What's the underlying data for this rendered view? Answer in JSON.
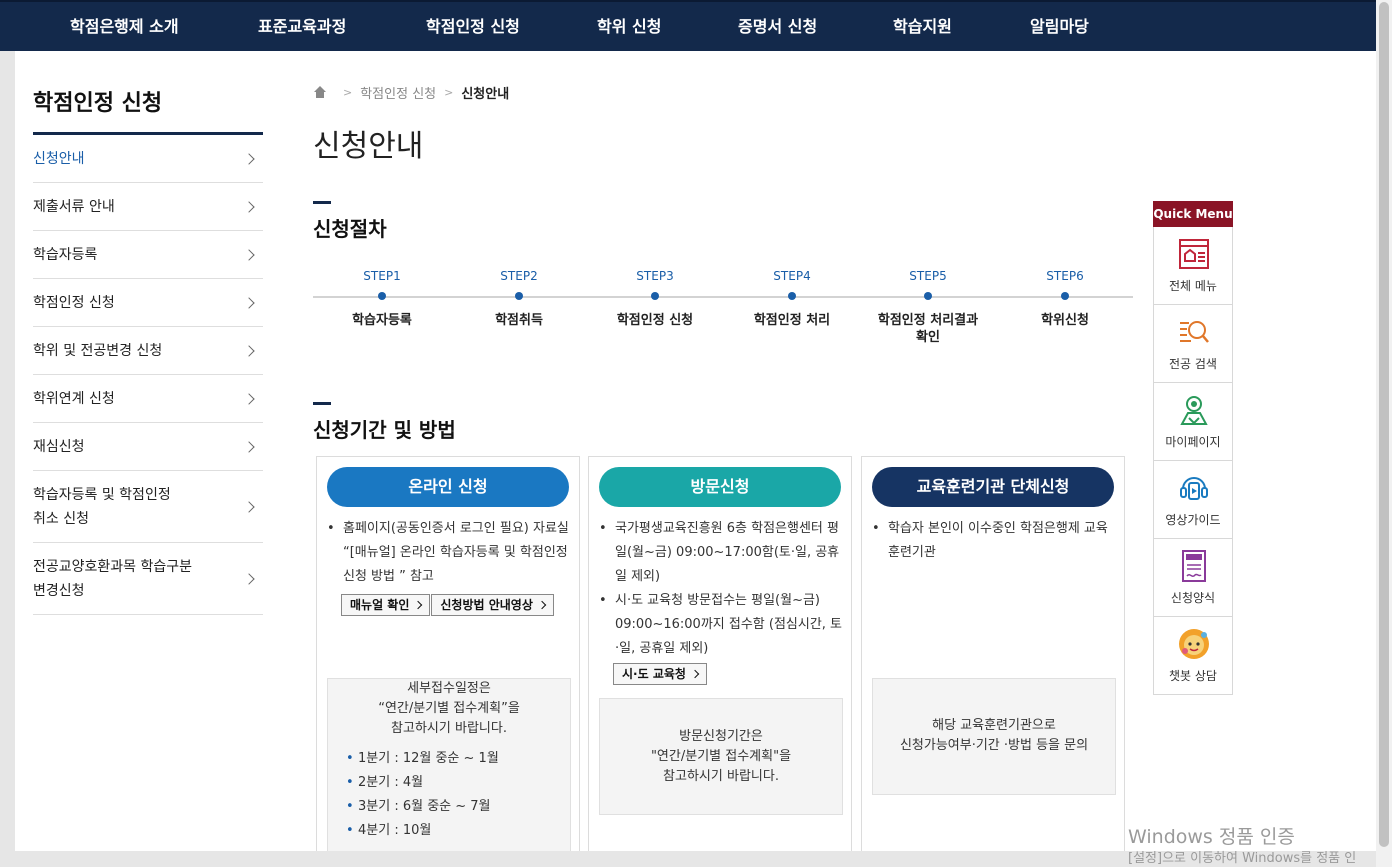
{
  "topnav": [
    "학점은행제 소개",
    "표준교육과정",
    "학점인정 신청",
    "학위 신청",
    "증명서 신청",
    "학습지원",
    "알림마당"
  ],
  "sidebar": {
    "title": "학점인정 신청",
    "items": [
      {
        "label": "신청안내"
      },
      {
        "label": "제출서류 안내"
      },
      {
        "label": "학습자등록"
      },
      {
        "label": "학점인정 신청"
      },
      {
        "label": "학위 및 전공변경 신청"
      },
      {
        "label": "학위연계 신청"
      },
      {
        "label": "재심신청"
      },
      {
        "label": "학습자등록 및 학점인정",
        "label2": "취소 신청"
      },
      {
        "label": "전공교양호환과목 학습구분",
        "label2": "변경신청"
      }
    ]
  },
  "breadcrumb": {
    "parent": "학점인정 신청",
    "current": "신청안내"
  },
  "page_title": "신청안내",
  "procedure": {
    "title": "신청절차",
    "steps": [
      {
        "label": "STEP1",
        "name": "학습자등록"
      },
      {
        "label": "STEP2",
        "name": "학점취득"
      },
      {
        "label": "STEP3",
        "name": "학점인정 신청"
      },
      {
        "label": "STEP4",
        "name": "학점인정 처리"
      },
      {
        "label": "STEP5",
        "name": "학점인정 처리결과",
        "name2": "확인"
      },
      {
        "label": "STEP6",
        "name": "학위신청"
      }
    ]
  },
  "period": {
    "title": "신청기간 및 방법",
    "online": {
      "title": "온라인 신청",
      "bullet1": "홈페이지(공동인증서 로그인 필요) 자료실 “[매뉴얼] 온라인 학습자등록 및 학점인정신청 방법 ” 참고",
      "btn1": "매뉴얼 확인",
      "btn2": "신청방법 안내영상",
      "q1": "1분기 : 12월 중순 ~ 1월",
      "q2": "2분기 : 4월",
      "q3": "3분기 : 6월 중순 ~ 7월",
      "q4": "4분기 : 10월",
      "note1": "세부접수일정은",
      "note2": "“연간/분기별 접수계획”을",
      "note3": "참고하시기 바랍니다."
    },
    "visit": {
      "title": "방문신청",
      "bullet1": "국가평생교육진흥원 6층 학점은행센터 평일(월~금) 09:00~17:00함(토·일, 공휴일 제외)",
      "bullet2": "시·도 교육청 방문접수는 평일(월~금) 09:00~16:00까지 접수함 (점심시간, 토·일, 공휴일 제외)",
      "btn": "시·도 교육청",
      "note1": "방문신청기간은",
      "note2": "\"연간/분기별 접수계획\"을",
      "note3": "참고하시기 바랍니다."
    },
    "group": {
      "title": "교육훈련기관 단체신청",
      "bullet1": "학습자 본인이 이수중인 학점은행제 교육훈련기관",
      "note1": "해당 교육훈련기관으로",
      "note2": "신청가능여부·기간 ·방법 등을 문의"
    }
  },
  "quick": {
    "title": "Quick Menu",
    "items": [
      "전체 메뉴",
      "전공 검색",
      "마이페이지",
      "영상가이드",
      "신청양식",
      "챗봇 상담"
    ]
  },
  "watermark": {
    "line1": "Windows 정품 인증",
    "line2": "[설정]으로 이동하여 Windows를 정품 인"
  },
  "colors": {
    "nav": "#13294b",
    "accent": "#1a5ea8",
    "online": "#1a78c2",
    "visit": "#1aa7a7",
    "group": "#163463",
    "quick": "#8a1426"
  }
}
